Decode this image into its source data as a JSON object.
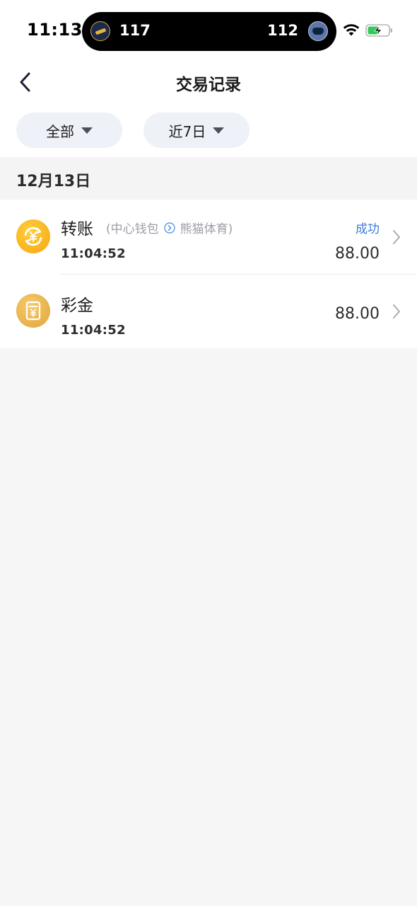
{
  "status_bar": {
    "time": "11:13",
    "live_activity": {
      "home_team_icon": "jazz-logo-icon",
      "home_score": "117",
      "away_score": "112",
      "away_team_icon": "grizzlies-logo-icon"
    },
    "wifi_icon": "wifi-icon",
    "battery_icon": "battery-charging-icon"
  },
  "nav": {
    "back_icon": "chevron-left-icon",
    "title": "交易记录"
  },
  "filters": {
    "type": {
      "label": "全部",
      "icon": "caret-down-icon"
    },
    "range": {
      "label": "近7日",
      "icon": "caret-down-icon"
    }
  },
  "date_group": {
    "label": "12月13日",
    "transactions": [
      {
        "icon": "transfer-yen-icon",
        "title": "转账",
        "route_prefix": "(中心钱包",
        "route_arrow_icon": "circle-arrow-right-icon",
        "route_suffix": "熊猫体育)",
        "status": "成功",
        "time": "11:04:52",
        "amount": "88.00"
      },
      {
        "icon": "bonus-voucher-icon",
        "title": "彩金",
        "time": "11:04:52",
        "amount": "88.00"
      }
    ]
  },
  "colors": {
    "status_success": "#3d7cdc",
    "accent_orange": "#f6a512",
    "page_bg": "#f6f6f6",
    "chip_bg": "#eef1f7"
  }
}
